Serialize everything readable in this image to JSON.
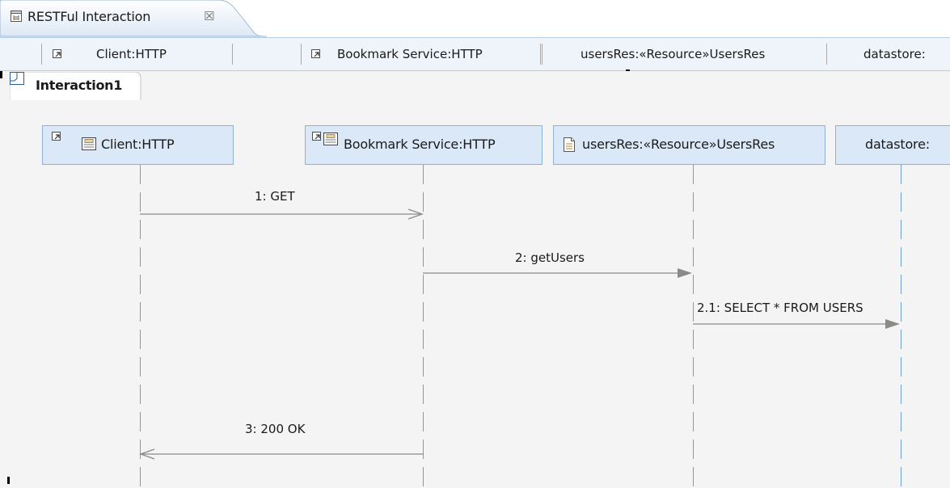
{
  "editor": {
    "tab_title": "RESTFul Interaction",
    "tab_close": "☒",
    "tab_icon": "sequence-diagram-icon"
  },
  "ruler": {
    "items": [
      {
        "label": "Client:HTTP"
      },
      {
        "label": "Bookmark Service:HTTP"
      },
      {
        "label": "usersRes:«Resource»UsersRes"
      },
      {
        "label": "datastore:"
      }
    ]
  },
  "diagram": {
    "frame_label": "Interaction1",
    "lifelines": [
      {
        "label": "Client:HTTP",
        "icon": "interface-component-icon"
      },
      {
        "label": "Bookmark Service:HTTP",
        "icon": "interface-component-icon"
      },
      {
        "label": "usersRes:«Resource»UsersRes",
        "icon": "document-icon"
      },
      {
        "label": "datastore:"
      }
    ],
    "messages": [
      {
        "label": "1: GET",
        "kind": "asynchronous",
        "from": "Client:HTTP",
        "to": "Bookmark Service:HTTP"
      },
      {
        "label": "2: getUsers",
        "kind": "synchronous",
        "from": "Bookmark Service:HTTP",
        "to": "usersRes:«Resource»UsersRes"
      },
      {
        "label": "2.1: SELECT * FROM USERS",
        "kind": "synchronous",
        "from": "usersRes:«Resource»UsersRes",
        "to": "datastore:"
      },
      {
        "label": "3: 200 OK",
        "kind": "asynchronous",
        "from": "Bookmark Service:HTTP",
        "to": "Client:HTTP"
      }
    ]
  },
  "colors": {
    "lifeline_fill": "#dbe8f7",
    "lifeline_border": "#8fb1d6",
    "lifeline_dash": "#6e9fd2",
    "message_line": "#8a8a8a"
  }
}
